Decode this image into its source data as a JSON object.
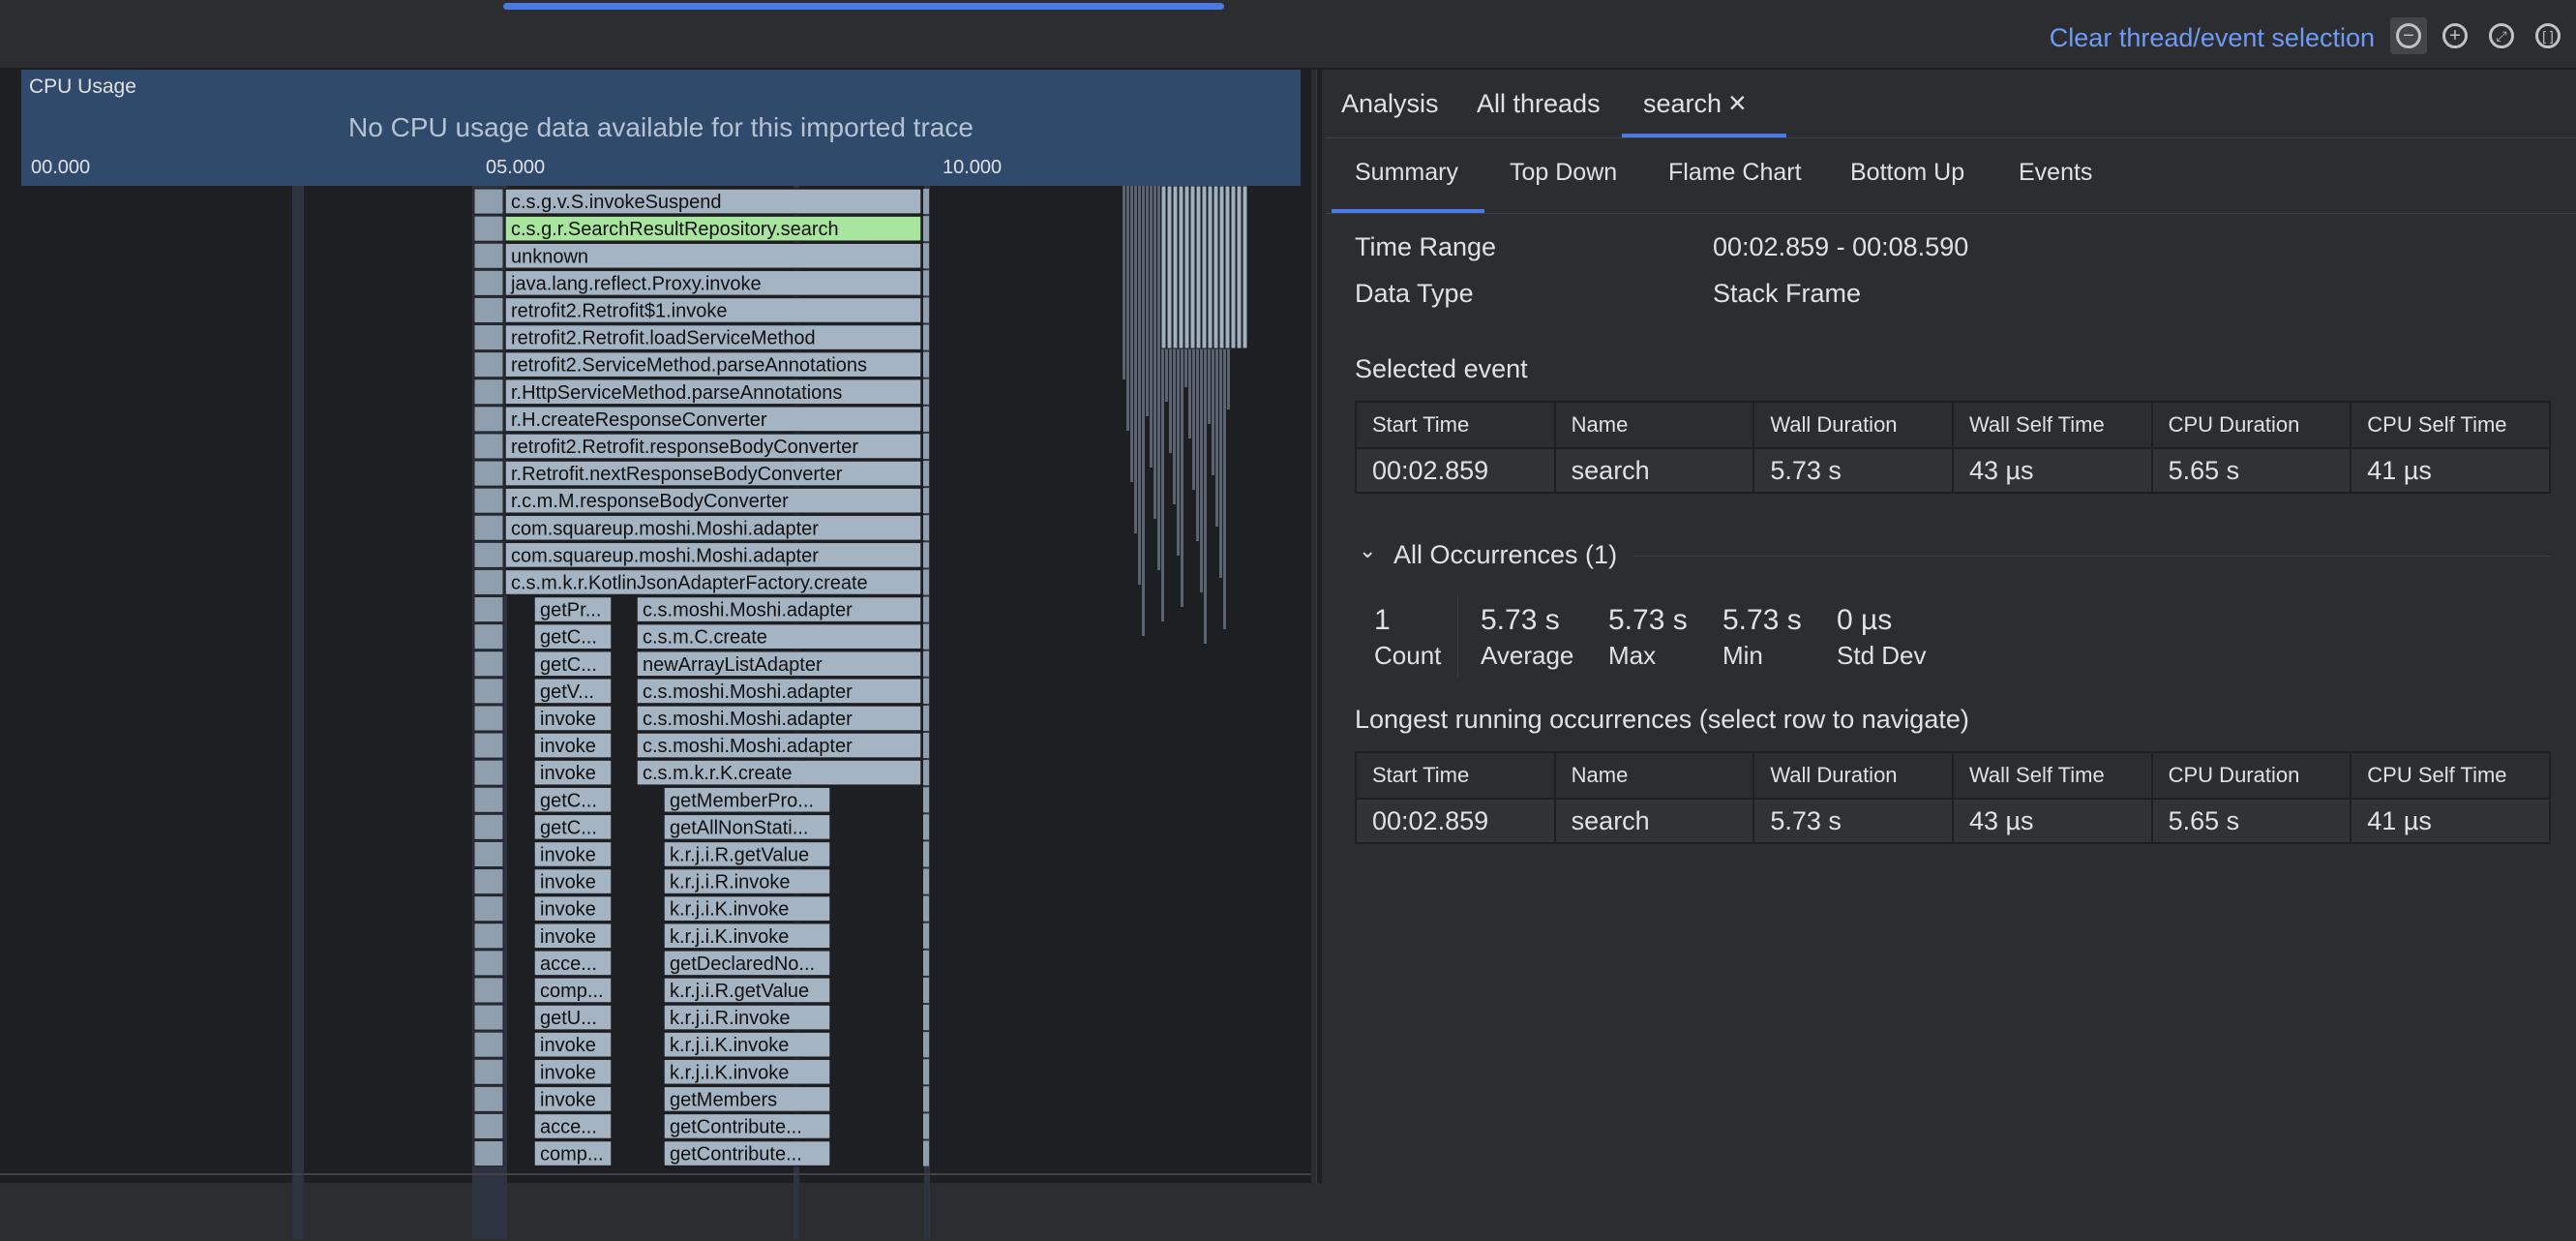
{
  "toolbar": {
    "clear_selection": "Clear thread/event selection"
  },
  "cpu_usage": {
    "title": "CPU Usage",
    "message": "No CPU usage data available for this imported trace",
    "ticks": [
      "00.000",
      "05.000",
      "10.000"
    ]
  },
  "flame_frames": [
    {
      "label": "c.s.g.v.S.invokeSuspend",
      "depth": 0,
      "col": 0,
      "highlight": false
    },
    {
      "label": "c.s.g.r.SearchResultRepository.search",
      "depth": 1,
      "col": 0,
      "highlight": true
    },
    {
      "label": "unknown",
      "depth": 2,
      "col": 0,
      "highlight": false
    },
    {
      "label": "java.lang.reflect.Proxy.invoke",
      "depth": 3,
      "col": 0,
      "highlight": false
    },
    {
      "label": "retrofit2.Retrofit$1.invoke",
      "depth": 4,
      "col": 0,
      "highlight": false
    },
    {
      "label": "retrofit2.Retrofit.loadServiceMethod",
      "depth": 5,
      "col": 0,
      "highlight": false
    },
    {
      "label": "retrofit2.ServiceMethod.parseAnnotations",
      "depth": 6,
      "col": 0,
      "highlight": false
    },
    {
      "label": "r.HttpServiceMethod.parseAnnotations",
      "depth": 7,
      "col": 0,
      "highlight": false
    },
    {
      "label": "r.H.createResponseConverter",
      "depth": 8,
      "col": 0,
      "highlight": false
    },
    {
      "label": "retrofit2.Retrofit.responseBodyConverter",
      "depth": 9,
      "col": 0,
      "highlight": false
    },
    {
      "label": "r.Retrofit.nextResponseBodyConverter",
      "depth": 10,
      "col": 0,
      "highlight": false
    },
    {
      "label": "r.c.m.M.responseBodyConverter",
      "depth": 11,
      "col": 0,
      "highlight": false
    },
    {
      "label": "com.squareup.moshi.Moshi.adapter",
      "depth": 12,
      "col": 0,
      "highlight": false
    },
    {
      "label": "com.squareup.moshi.Moshi.adapter",
      "depth": 13,
      "col": 0,
      "highlight": false
    },
    {
      "label": "c.s.m.k.r.KotlinJsonAdapterFactory.create",
      "depth": 14,
      "col": 0,
      "highlight": false
    },
    {
      "label": "getPr...",
      "depth": 15,
      "col": 1
    },
    {
      "label": "c.s.moshi.Moshi.adapter",
      "depth": 15,
      "col": 2
    },
    {
      "label": "getC...",
      "depth": 16,
      "col": 1
    },
    {
      "label": "c.s.m.C.create",
      "depth": 16,
      "col": 2
    },
    {
      "label": "getC...",
      "depth": 17,
      "col": 1
    },
    {
      "label": "newArrayListAdapter",
      "depth": 17,
      "col": 2
    },
    {
      "label": "getV...",
      "depth": 18,
      "col": 1
    },
    {
      "label": "c.s.moshi.Moshi.adapter",
      "depth": 18,
      "col": 2
    },
    {
      "label": "invoke",
      "depth": 19,
      "col": 1
    },
    {
      "label": "c.s.moshi.Moshi.adapter",
      "depth": 19,
      "col": 2
    },
    {
      "label": "invoke",
      "depth": 20,
      "col": 1
    },
    {
      "label": "c.s.moshi.Moshi.adapter",
      "depth": 20,
      "col": 2
    },
    {
      "label": "invoke",
      "depth": 21,
      "col": 1
    },
    {
      "label": "c.s.m.k.r.K.create",
      "depth": 21,
      "col": 2
    },
    {
      "label": "getC...",
      "depth": 22,
      "col": 1
    },
    {
      "label": "getMemberPro...",
      "depth": 22,
      "col": 3
    },
    {
      "label": "getC...",
      "depth": 23,
      "col": 1
    },
    {
      "label": "getAllNonStati...",
      "depth": 23,
      "col": 3
    },
    {
      "label": "invoke",
      "depth": 24,
      "col": 1
    },
    {
      "label": "k.r.j.i.R.getValue",
      "depth": 24,
      "col": 3
    },
    {
      "label": "invoke",
      "depth": 25,
      "col": 1
    },
    {
      "label": "k.r.j.i.R.invoke",
      "depth": 25,
      "col": 3
    },
    {
      "label": "invoke",
      "depth": 26,
      "col": 1
    },
    {
      "label": "k.r.j.i.K.invoke",
      "depth": 26,
      "col": 3
    },
    {
      "label": "invoke",
      "depth": 27,
      "col": 1
    },
    {
      "label": "k.r.j.i.K.invoke",
      "depth": 27,
      "col": 3
    },
    {
      "label": "acce...",
      "depth": 28,
      "col": 1
    },
    {
      "label": "getDeclaredNo...",
      "depth": 28,
      "col": 3
    },
    {
      "label": "comp...",
      "depth": 29,
      "col": 1
    },
    {
      "label": "k.r.j.i.R.getValue",
      "depth": 29,
      "col": 3
    },
    {
      "label": "getU...",
      "depth": 30,
      "col": 1
    },
    {
      "label": "k.r.j.i.R.invoke",
      "depth": 30,
      "col": 3
    },
    {
      "label": "invoke",
      "depth": 31,
      "col": 1
    },
    {
      "label": "k.r.j.i.K.invoke",
      "depth": 31,
      "col": 3
    },
    {
      "label": "invoke",
      "depth": 32,
      "col": 1
    },
    {
      "label": "k.r.j.i.K.invoke",
      "depth": 32,
      "col": 3
    },
    {
      "label": "invoke",
      "depth": 33,
      "col": 1
    },
    {
      "label": "getMembers",
      "depth": 33,
      "col": 3
    },
    {
      "label": "acce...",
      "depth": 34,
      "col": 1
    },
    {
      "label": "getContribute...",
      "depth": 34,
      "col": 3
    },
    {
      "label": "comp...",
      "depth": 35,
      "col": 1
    },
    {
      "label": "getContribute...",
      "depth": 35,
      "col": 3
    }
  ],
  "tabs": [
    {
      "label": "Analysis"
    },
    {
      "label": "All threads"
    },
    {
      "label": "search",
      "active": true
    }
  ],
  "subtabs": [
    {
      "label": "Summary",
      "active": true
    },
    {
      "label": "Top Down"
    },
    {
      "label": "Flame Chart"
    },
    {
      "label": "Bottom Up"
    },
    {
      "label": "Events"
    }
  ],
  "summary": {
    "time_range_label": "Time Range",
    "time_range_value": "00:02.859 - 00:08.590",
    "data_type_label": "Data Type",
    "data_type_value": "Stack Frame",
    "selected_event_title": "Selected event",
    "columns": [
      "Start Time",
      "Name",
      "Wall Duration",
      "Wall Self Time",
      "CPU Duration",
      "CPU Self Time"
    ],
    "selected_row": [
      "00:02.859",
      "search",
      "5.73 s",
      "43 µs",
      "5.65 s",
      "41 µs"
    ],
    "all_occurrences_title": "All Occurrences (1)",
    "stats": [
      {
        "value": "1",
        "label": "Count"
      },
      {
        "value": "5.73 s",
        "label": "Average"
      },
      {
        "value": "5.73 s",
        "label": "Max"
      },
      {
        "value": "5.73 s",
        "label": "Min"
      },
      {
        "value": "0 µs",
        "label": "Std Dev"
      }
    ],
    "longest_title": "Longest running occurrences (select row to navigate)",
    "longest_row": [
      "00:02.859",
      "search",
      "5.73 s",
      "43 µs",
      "5.65 s",
      "41 µs"
    ]
  },
  "colors": {
    "accent": "#4a7ae6",
    "link": "#6e9bf5",
    "frame": "#a4b4c3",
    "frame_highlight": "#a8e6a0",
    "cpu_panel": "#2f4a6b"
  }
}
